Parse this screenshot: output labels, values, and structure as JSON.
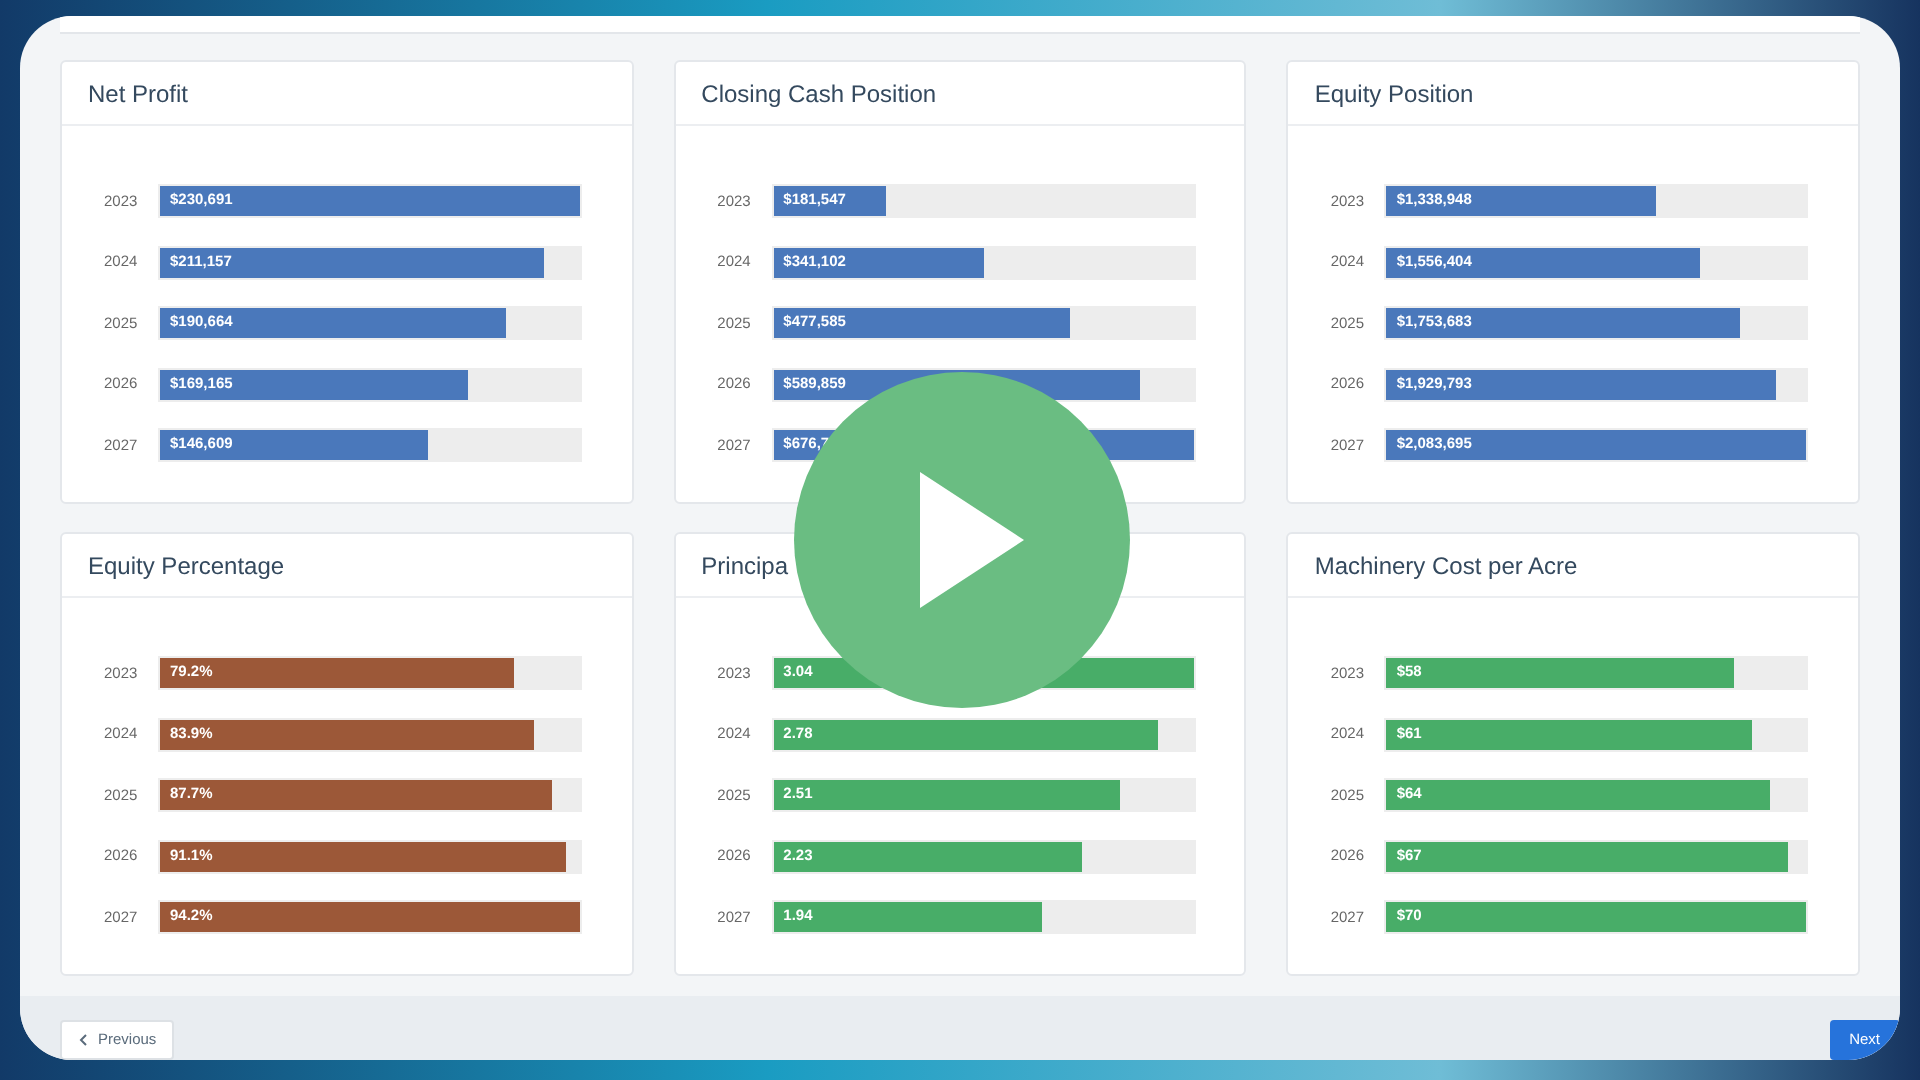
{
  "cards": [
    {
      "title": "Net Profit",
      "color": "#4a78bb",
      "rows": [
        {
          "year": "2023",
          "value": "$230,691",
          "level": 1
        },
        {
          "year": "2024",
          "value": "$211,157",
          "level": 0.915
        },
        {
          "year": "2025",
          "value": "$190,664",
          "level": 0.826
        },
        {
          "year": "2026",
          "value": "$169,165",
          "level": 0.733
        },
        {
          "year": "2027",
          "value": "$146,609",
          "level": 0.636
        }
      ]
    },
    {
      "title": "Closing Cash Position",
      "color": "#4a78bb",
      "rows": [
        {
          "year": "2023",
          "value": "$181,547",
          "level": 0.268
        },
        {
          "year": "2024",
          "value": "$341,102",
          "level": 0.504
        },
        {
          "year": "2025",
          "value": "$477,585",
          "level": 0.706
        },
        {
          "year": "2026",
          "value": "$589,859",
          "level": 0.872
        },
        {
          "year": "2027",
          "value": "$676,7",
          "level": 1
        }
      ]
    },
    {
      "title": "Equity Position",
      "color": "#4a78bb",
      "rows": [
        {
          "year": "2023",
          "value": "$1,338,948",
          "level": 0.643
        },
        {
          "year": "2024",
          "value": "$1,556,404",
          "level": 0.747
        },
        {
          "year": "2025",
          "value": "$1,753,683",
          "level": 0.842
        },
        {
          "year": "2026",
          "value": "$1,929,793",
          "level": 0.926
        },
        {
          "year": "2027",
          "value": "$2,083,695",
          "level": 1
        }
      ]
    },
    {
      "title": "Equity Percentage",
      "color": "#9c5838",
      "rows": [
        {
          "year": "2023",
          "value": "79.2%",
          "level": 0.841
        },
        {
          "year": "2024",
          "value": "83.9%",
          "level": 0.891
        },
        {
          "year": "2025",
          "value": "87.7%",
          "level": 0.931
        },
        {
          "year": "2026",
          "value": "91.1%",
          "level": 0.967
        },
        {
          "year": "2027",
          "value": "94.2%",
          "level": 1
        }
      ]
    },
    {
      "title": "Principa",
      "color": "#48ad68",
      "rows": [
        {
          "year": "2023",
          "value": "3.04",
          "level": 1
        },
        {
          "year": "2024",
          "value": "2.78",
          "level": 0.914
        },
        {
          "year": "2025",
          "value": "2.51",
          "level": 0.826
        },
        {
          "year": "2026",
          "value": "2.23",
          "level": 0.734
        },
        {
          "year": "2027",
          "value": "1.94",
          "level": 0.638
        }
      ]
    },
    {
      "title": "Machinery Cost per Acre",
      "color": "#48ad68",
      "rows": [
        {
          "year": "2023",
          "value": "$58",
          "level": 0.829
        },
        {
          "year": "2024",
          "value": "$61",
          "level": 0.871
        },
        {
          "year": "2025",
          "value": "$64",
          "level": 0.914
        },
        {
          "year": "2026",
          "value": "$67",
          "level": 0.957
        },
        {
          "year": "2027",
          "value": "$70",
          "level": 1
        }
      ]
    }
  ],
  "footer": {
    "previous": "Previous",
    "next": "Next"
  }
}
